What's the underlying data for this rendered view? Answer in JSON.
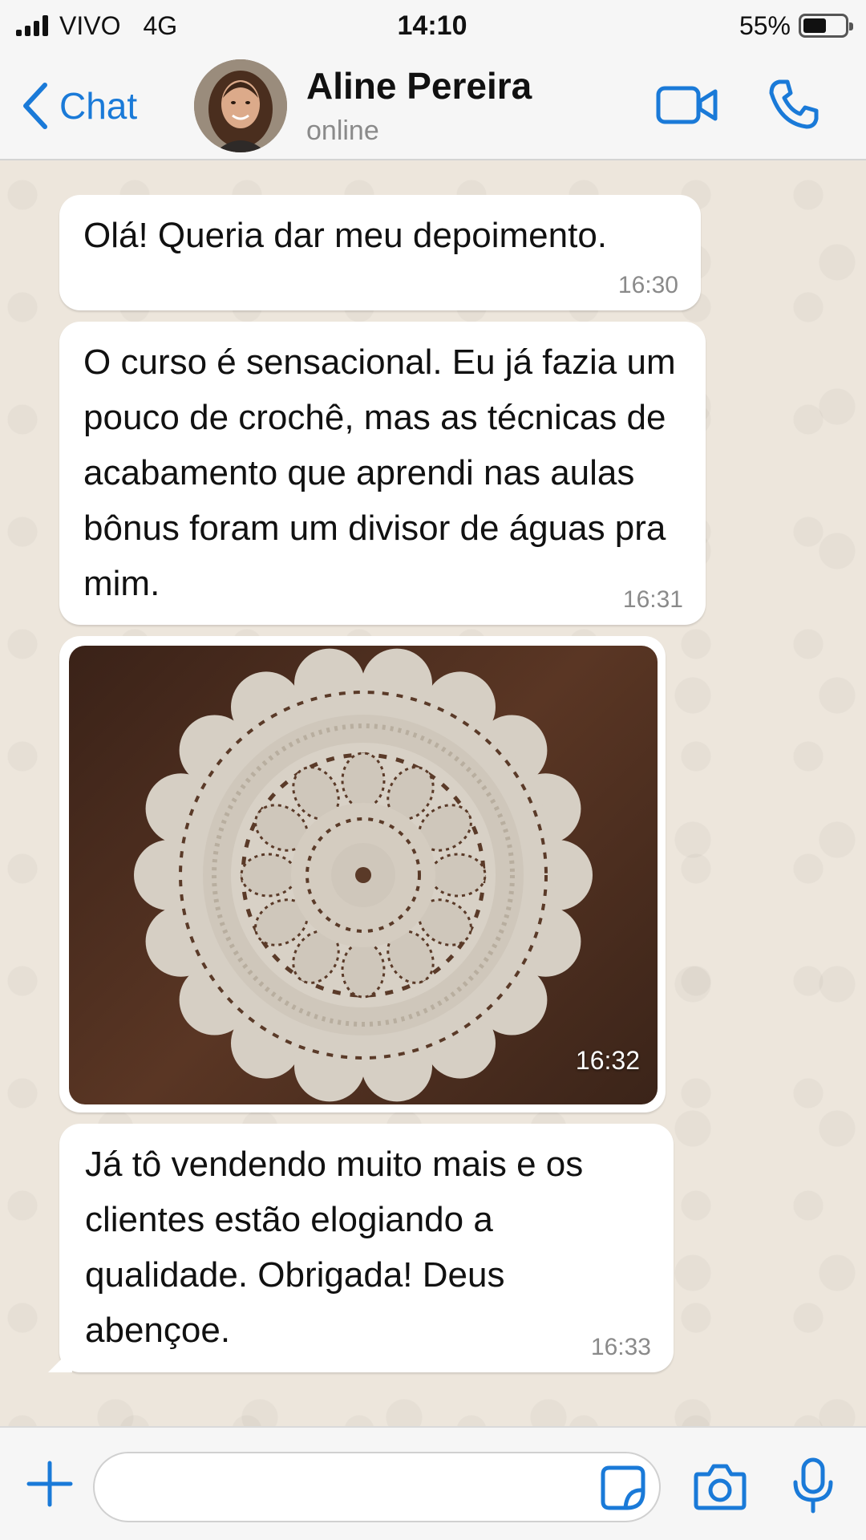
{
  "status_bar": {
    "carrier": "VIVO",
    "network": "4G",
    "time": "14:10",
    "battery_text": "55%",
    "battery_level": 0.55
  },
  "header": {
    "back_label": "Chat",
    "contact_name": "Aline Pereira",
    "contact_status": "online",
    "icons": [
      "chevron-left-icon",
      "avatar",
      "video-call-icon",
      "phone-call-icon"
    ]
  },
  "messages": [
    {
      "text": "Olá! Queria dar meu depoimento.",
      "time": "16:30"
    },
    {
      "text": "O curso é sensacional. Eu já fazia um pouco de crochê, mas as técnicas de acabamento que aprendi nas aulas bônus foram um divisor de águas pra mim.",
      "time": "16:31"
    },
    {
      "type": "image",
      "time": "16:32"
    },
    {
      "text": "Já tô vendendo muito mais e os clientes estão elogiando a qualidade. Obrigada! Deus abençoe.",
      "time": "16:33"
    }
  ],
  "input_bar": {
    "value": "",
    "placeholder": "",
    "icons": [
      "plus-icon",
      "sticker-icon",
      "camera-icon",
      "microphone-icon"
    ]
  },
  "colors": {
    "accent": "#1a7ad8",
    "chat_background": "#ede6dc",
    "bubble": "#ffffff",
    "photo_background": "#4a2c1e",
    "doily": "#d8d2c8"
  }
}
